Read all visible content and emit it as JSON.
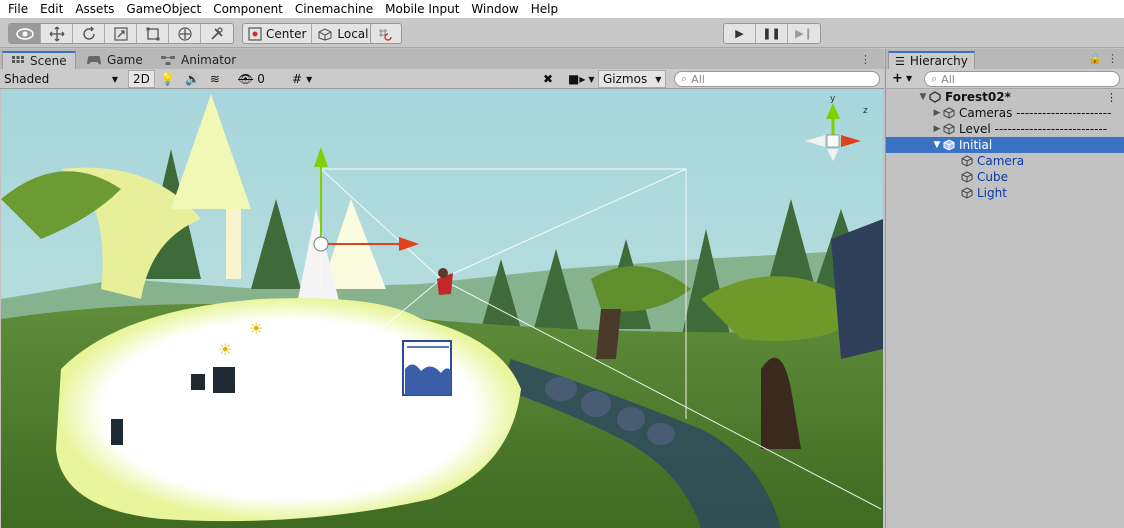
{
  "menu": [
    "File",
    "Edit",
    "Assets",
    "GameObject",
    "Component",
    "Cinemachine",
    "Mobile Input",
    "Window",
    "Help"
  ],
  "toolbar": {
    "tools": [
      "view-tool",
      "move-tool",
      "rotate-tool",
      "scale-tool",
      "rect-tool",
      "transform-tool",
      "custom-tool"
    ],
    "pivot_label": "Center",
    "space_label": "Local",
    "play_icons": [
      "play-icon",
      "pause-icon",
      "step-icon"
    ]
  },
  "tabs": [
    {
      "label": "Scene",
      "icon": "scene-icon",
      "active": true
    },
    {
      "label": "Game",
      "icon": "game-icon",
      "active": false
    },
    {
      "label": "Animator",
      "icon": "animator-icon",
      "active": false
    }
  ],
  "scene_toolbar": {
    "shading_mode": "Shaded",
    "mode_2d": "2D",
    "hidden_count": "0",
    "gizmos_label": "Gizmos",
    "search_placeholder": "All"
  },
  "hierarchy": {
    "title": "Hierarchy",
    "search_placeholder": "All",
    "scene_name": "Forest02*",
    "items": [
      {
        "label": "Cameras ----------------------",
        "depth": 1,
        "expanded": false,
        "selected": false,
        "prefab": false
      },
      {
        "label": "Level --------------------------",
        "depth": 1,
        "expanded": false,
        "selected": false,
        "prefab": false
      },
      {
        "label": "Initial",
        "depth": 1,
        "expanded": true,
        "selected": true,
        "prefab": true
      },
      {
        "label": "Camera",
        "depth": 2,
        "selected": false,
        "prefab": true
      },
      {
        "label": "Cube",
        "depth": 2,
        "selected": false,
        "prefab": true
      },
      {
        "label": "Light",
        "depth": 2,
        "selected": false,
        "prefab": true
      }
    ]
  },
  "colors": {
    "selection": "#3a72c4",
    "sky": "#a8d3d8",
    "grass": "#4f7a2e",
    "gizmo_y": "#7fd000",
    "gizmo_x": "#e0401c"
  }
}
